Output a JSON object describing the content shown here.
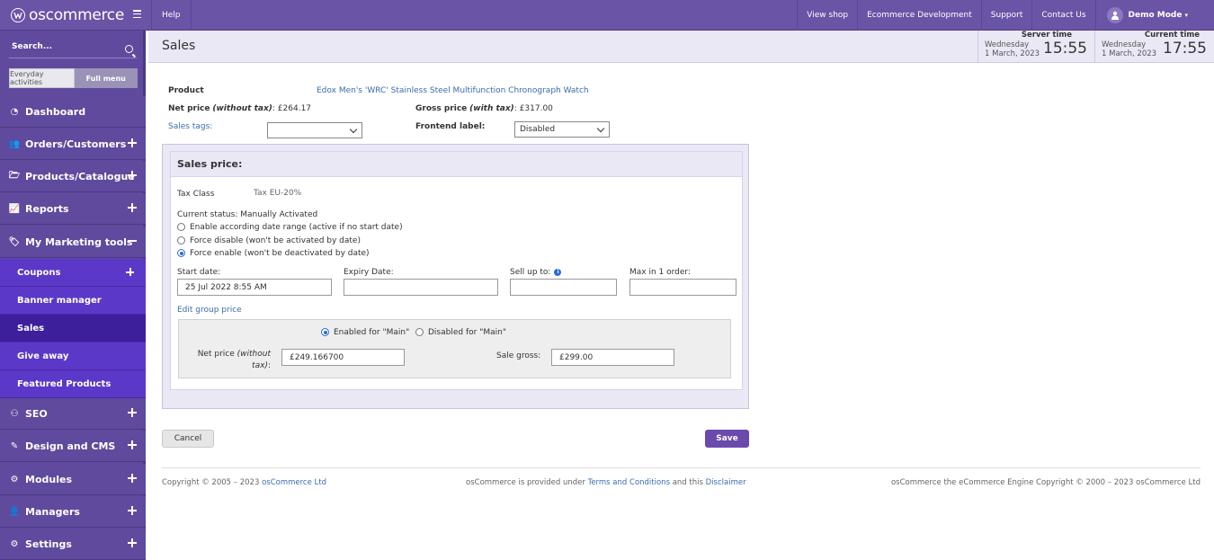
{
  "header": {
    "logo_text": "oscommerce",
    "help": "Help",
    "links": [
      "View shop",
      "Ecommerce Development",
      "Support",
      "Contact Us"
    ],
    "user": "Demo Mode"
  },
  "sidebar": {
    "search_placeholder": "Search...",
    "toggle_everyday": "Everyday activities",
    "toggle_full": "Full menu",
    "items": [
      {
        "label": "Dashboard"
      },
      {
        "label": "Orders/Customers"
      },
      {
        "label": "Products/Catalogue"
      },
      {
        "label": "Reports"
      },
      {
        "label": "My Marketing tools"
      },
      {
        "label": "SEO"
      },
      {
        "label": "Design and CMS"
      },
      {
        "label": "Modules"
      },
      {
        "label": "Managers"
      },
      {
        "label": "Settings"
      }
    ],
    "subitems": [
      {
        "label": "Coupons"
      },
      {
        "label": "Banner manager"
      },
      {
        "label": "Sales"
      },
      {
        "label": "Give away"
      },
      {
        "label": "Featured Products"
      }
    ]
  },
  "content_header": {
    "title": "Sales",
    "server_time": {
      "label": "Server time",
      "day": "Wednesday",
      "date": "1 March, 2023",
      "clock": "15:55"
    },
    "current_time": {
      "label": "Current time",
      "day": "Wednesday",
      "date": "1 March, 2023",
      "clock": "17:55"
    }
  },
  "product": {
    "product_label": "Product",
    "product_name": "Edox Men's 'WRC' Stainless Steel Multifunction Chronograph Watch",
    "net_label": "Net price",
    "net_suffix": "(without tax)",
    "net_value": ": £264.17",
    "gross_label": "Gross price",
    "gross_suffix": "(with tax)",
    "gross_value": ": £317.00",
    "sales_tags_label": "Sales tags:",
    "sales_tags_value": "",
    "frontend_label": "Frontend label:",
    "frontend_value": "Disabled"
  },
  "sales_price": {
    "heading": "Sales price:",
    "tax_class_label": "Tax Class",
    "tax_class_value": "Tax EU-20%",
    "status": "Current status: Manually Activated",
    "radio_options": [
      "Enable according date range (active if no start date)",
      "Force disable (won't be activated by date)",
      "Force enable (won't be deactivated by date)"
    ],
    "start_date_label": "Start date:",
    "start_date_value": "25 Jul 2022 8:55 AM",
    "expiry_label": "Expiry Date:",
    "expiry_value": "",
    "sell_up_label": "Sell up to:",
    "sell_up_value": "",
    "max_order_label": "Max in 1 order:",
    "max_order_value": "",
    "edit_group_link": "Edit group price",
    "enabled_main": "Enabled for \"Main\"",
    "disabled_main": "Disabled for \"Main\"",
    "net_price_label": "Net price",
    "net_price_suffix": "(without tax)",
    "net_price_value": "£249.166700",
    "sale_gross_label": "Sale gross:",
    "sale_gross_value": "£299.00"
  },
  "actions": {
    "cancel": "Cancel",
    "save": "Save"
  },
  "footer": {
    "copyright_prefix": "Copyright © 2005 – 2023",
    "copyright_link": "osCommerce Ltd",
    "provided_text": "osCommerce is provided under",
    "terms_link": "Terms and Conditions",
    "and_this": "and this",
    "disclaimer_link": "Disclaimer",
    "engine_text": "osCommerce the eCommerce Engine Copyright © 2000 – 2023 osCommerce Ltd"
  },
  "colors": {
    "brand": "#6a54a6",
    "submenu": "#5c38c8",
    "submenu_active": "#3d1f9c",
    "link": "#3a6cae"
  }
}
